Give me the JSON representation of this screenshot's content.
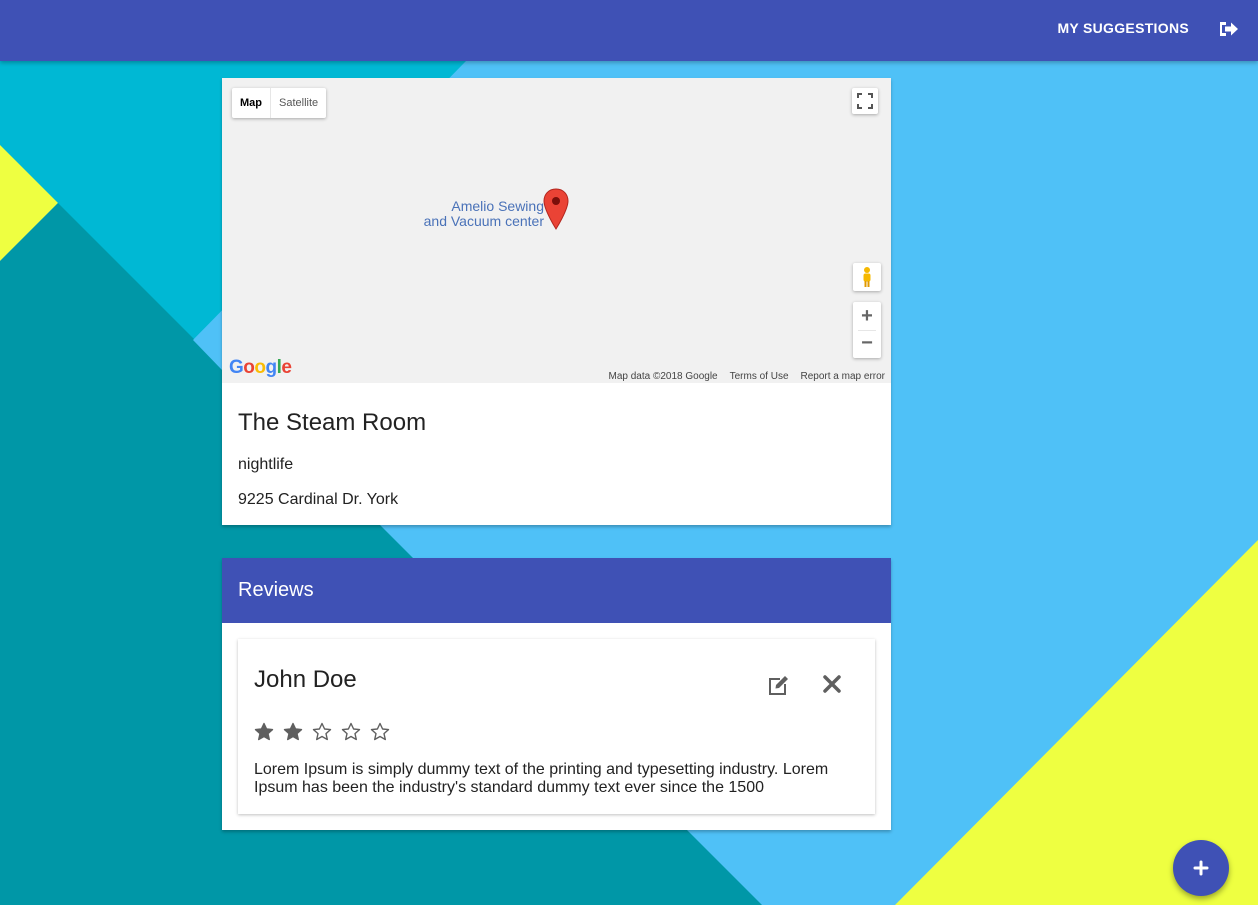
{
  "app_bar": {
    "nav_label": "MY SUGGESTIONS",
    "logout_icon": "sign-out-icon",
    "color": "#3f51b5"
  },
  "background": {
    "colors": [
      "#4fc1f7",
      "#00b8d4",
      "#0097a7",
      "#eeff41"
    ]
  },
  "map": {
    "type_options": [
      "Map",
      "Satellite"
    ],
    "selected_type": "Map",
    "marker_label_line1": "Amelio Sewing",
    "marker_label_line2": "and Vacuum center",
    "zoom_in": "+",
    "zoom_out": "−",
    "google_logo": [
      "G",
      "o",
      "o",
      "g",
      "l",
      "e"
    ],
    "footer": {
      "data": "Map data ©2018 Google",
      "terms": "Terms of Use",
      "report": "Report a map error"
    }
  },
  "place": {
    "name": "The Steam Room",
    "category": "nightlife",
    "address": "9225 Cardinal Dr. York"
  },
  "reviews": {
    "title": "Reviews",
    "items": [
      {
        "author": "John Doe",
        "rating": 2,
        "max_rating": 5,
        "text": "Lorem Ipsum is simply dummy text of the printing and typesetting industry. Lorem Ipsum has been the industry's standard dummy text ever since the 1500"
      }
    ]
  },
  "fab": {
    "icon": "plus-icon"
  }
}
